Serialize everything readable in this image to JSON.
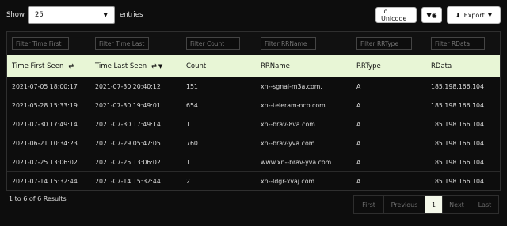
{
  "controls": {
    "show_label": "Show",
    "page_size": "25",
    "entries_label": "entries",
    "unicode_button": "To Unicode",
    "filter_toggle_icon": "filter-eye-icon",
    "export_label": "Export"
  },
  "filters": {
    "time_first_placeholder": "Filter Time First",
    "time_last_placeholder": "Filter Time Last",
    "count_placeholder": "Filter Count",
    "rrname_placeholder": "Filter RRName",
    "rrtype_placeholder": "Filter RRType",
    "rdata_placeholder": "Filter RData"
  },
  "columns": {
    "time_first": "Time First Seen",
    "time_last": "Time Last Seen",
    "count": "Count",
    "rrname": "RRName",
    "rrtype": "RRType",
    "rdata": "RData"
  },
  "rows": [
    {
      "first": "2021-07-05 18:00:17",
      "last": "2021-07-30 20:40:12",
      "count": "151",
      "rrname": "xn--sgnal-m3a.com.",
      "rrtype": "A",
      "rdata": "185.198.166.104"
    },
    {
      "first": "2021-05-28 15:33:19",
      "last": "2021-07-30 19:49:01",
      "count": "654",
      "rrname": "xn--teleram-ncb.com.",
      "rrtype": "A",
      "rdata": "185.198.166.104"
    },
    {
      "first": "2021-07-30 17:49:14",
      "last": "2021-07-30 17:49:14",
      "count": "1",
      "rrname": "xn--brav-8va.com.",
      "rrtype": "A",
      "rdata": "185.198.166.104"
    },
    {
      "first": "2021-06-21 10:34:23",
      "last": "2021-07-29 05:47:05",
      "count": "760",
      "rrname": "xn--brav-yva.com.",
      "rrtype": "A",
      "rdata": "185.198.166.104"
    },
    {
      "first": "2021-07-25 13:06:02",
      "last": "2021-07-25 13:06:02",
      "count": "1",
      "rrname": "www.xn--brav-yva.com.",
      "rrtype": "A",
      "rdata": "185.198.166.104"
    },
    {
      "first": "2021-07-14 15:32:44",
      "last": "2021-07-14 15:32:44",
      "count": "2",
      "rrname": "xn--ldgr-xvaj.com.",
      "rrtype": "A",
      "rdata": "185.198.166.104"
    }
  ],
  "footer": {
    "results_text": "1 to 6 of 6 Results"
  },
  "pagination": {
    "first": "First",
    "previous": "Previous",
    "current": "1",
    "next": "Next",
    "last": "Last"
  }
}
